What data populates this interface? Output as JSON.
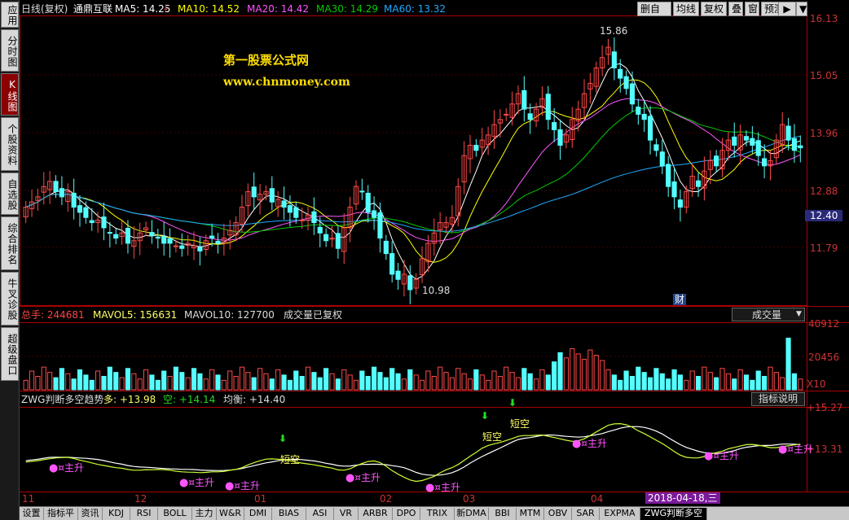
{
  "sidebar": {
    "tabs": [
      "应用",
      "分时图",
      "K线图",
      "个股资料",
      "自选股",
      "综合排名",
      "牛叉诊股",
      "超级盘口"
    ],
    "active_index": 2
  },
  "header": {
    "period": "日线(复权)",
    "stock": "通鼎互联",
    "ma5": "MA5: 14.25",
    "ma10": "MA10: 14.52",
    "ma20": "MA20: 14.42",
    "ma30": "MA30: 14.29",
    "ma60": "MA60: 13.32",
    "ma_colors": [
      "#ffffff",
      "#ffff00",
      "#ff55ff",
      "#00cc00",
      "#22aaff"
    ]
  },
  "toolbar": {
    "buttons": [
      "删自选",
      "均线",
      "复权",
      "叠",
      "窗",
      "预测"
    ],
    "arrow_label": "▶",
    "dropdown_label": "▼"
  },
  "watermark": {
    "line1": "第一股票公式网",
    "line2": "www.chnmoney.com"
  },
  "price_axis": {
    "labels": [
      "16.13",
      "15.05",
      "13.96",
      "12.88",
      "12.40",
      "11.79"
    ],
    "current": "12.40",
    "high_note": "15.86",
    "low_note": "10.98",
    "cai": "财"
  },
  "volume": {
    "total": "总手: 244681",
    "mavol5": "MAVOL5: 156631",
    "mavol10": "MAVOL10: 127700",
    "note": "成交量已复权",
    "dropdown": "成交量",
    "axis": [
      "40912",
      "20456",
      "X10"
    ]
  },
  "indicator": {
    "name": "ZWG判断多空趋势",
    "duo": "多: +13.98",
    "kong": "空: +14.14",
    "junheng": "均衡: +14.40",
    "button": "指标说明",
    "axis": [
      "+15.27",
      "+13.31"
    ],
    "marks_up": [
      "¤主升",
      "¤主升",
      "¤主升",
      "¤主升",
      "¤主升",
      "¤主升",
      "¤主升"
    ],
    "marks_dn": [
      "短空",
      "短空",
      "短空"
    ]
  },
  "time_axis": {
    "labels": [
      "11",
      "12",
      "01",
      "02",
      "03",
      "04"
    ],
    "date_badge": "2018-04-18,三"
  },
  "bottom_tabs": [
    "设置",
    "指标平台",
    "资讯",
    "KDJ",
    "RSI",
    "BOLL",
    "主力",
    "W&R",
    "DMI",
    "BIAS",
    "ASI",
    "VR",
    "ARBR",
    "DPO",
    "TRIX",
    "新DMA",
    "BBI",
    "MTM",
    "OBV",
    "SAR",
    "EXPMA",
    "ZWG判断多空趋势"
  ],
  "chart_data": {
    "type": "candlestick",
    "title": "通鼎互联 日线(复权)",
    "ylim": [
      10.7,
      16.3
    ],
    "x_months": [
      "11",
      "12",
      "01",
      "02",
      "03",
      "04"
    ],
    "closes": [
      12.6,
      12.7,
      12.8,
      13.0,
      13.1,
      12.9,
      12.8,
      12.9,
      12.6,
      12.5,
      12.4,
      12.3,
      12.35,
      12.2,
      12.1,
      12.0,
      12.1,
      11.9,
      11.95,
      12.1,
      12.2,
      12.05,
      12.0,
      11.9,
      11.9,
      11.85,
      11.8,
      11.9,
      11.85,
      11.75,
      11.95,
      12.0,
      11.9,
      12.0,
      12.15,
      12.3,
      12.6,
      12.9,
      12.8,
      12.85,
      12.9,
      12.7,
      12.75,
      12.6,
      12.5,
      12.4,
      12.35,
      12.45,
      12.3,
      12.1,
      11.95,
      12.0,
      11.8,
      12.2,
      12.6,
      13.0,
      12.9,
      12.5,
      12.4,
      12.0,
      11.7,
      11.3,
      11.2,
      11.3,
      11.0,
      11.2,
      11.6,
      11.9,
      12.1,
      12.3,
      12.3,
      12.4,
      13.0,
      13.6,
      13.8,
      13.7,
      13.9,
      14.0,
      14.2,
      14.3,
      14.4,
      14.6,
      14.8,
      14.5,
      14.3,
      14.5,
      14.7,
      14.3,
      14.1,
      13.8,
      14.0,
      14.3,
      14.5,
      14.8,
      15.0,
      15.3,
      15.5,
      15.7,
      15.3,
      15.1,
      14.9,
      14.6,
      14.4,
      14.3,
      13.9,
      13.7,
      13.4,
      13.0,
      12.8,
      12.6,
      12.9,
      13.2,
      13.0,
      13.3,
      13.5,
      13.4,
      13.7,
      13.9,
      13.8,
      14.0,
      13.9,
      13.8,
      13.6,
      13.4,
      13.5,
      13.9,
      14.2,
      13.9,
      13.7,
      13.75
    ]
  }
}
